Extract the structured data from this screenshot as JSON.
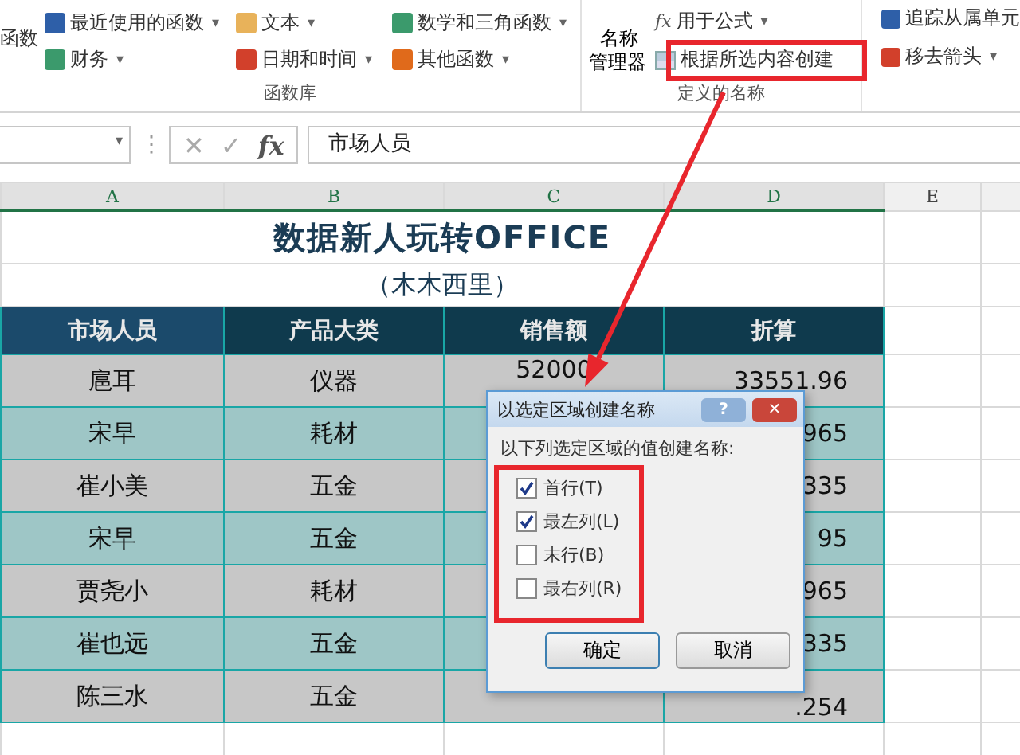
{
  "ribbon": {
    "cut_button": "函数",
    "function_library": {
      "label": "函数库",
      "items": [
        {
          "label": "最近使用的函数",
          "dropdown": "▾"
        },
        {
          "label": "财务",
          "dropdown": "▾"
        },
        {
          "label": "文本",
          "dropdown": "▾"
        },
        {
          "label": "日期和时间",
          "dropdown": "▾"
        },
        {
          "label": "数学和三角函数",
          "dropdown": "▾"
        },
        {
          "label": "其他函数",
          "dropdown": "▾"
        }
      ]
    },
    "defined_names": {
      "label": "定义的名称",
      "formula_icon": "fx",
      "manager": "名称管理器",
      "use_in_formula": "用于公式",
      "use_dropdown": "▾",
      "create_from_selection": "根据所选内容创建"
    },
    "auditing": {
      "items": [
        "追踪从属单元",
        "移去箭头"
      ],
      "dropdown": "▾"
    }
  },
  "formula_bar": {
    "name_dropdown": "▾",
    "more": "⋮",
    "cancel": "✕",
    "enter": "✓",
    "function": "fx",
    "content": "市场人员"
  },
  "sheet": {
    "columns": [
      "A",
      "B",
      "C",
      "D",
      "E"
    ],
    "title": "数据新人玩转OFFICE",
    "subtitle": "（木木西里）",
    "header": [
      "市场人员",
      "产品大类",
      "销售额",
      "折算"
    ],
    "rows": [
      {
        "cells": [
          "扈耳",
          "仪器",
          "52000",
          "33551.96"
        ]
      },
      {
        "cells": [
          "宋早",
          "耗材",
          "",
          "965"
        ]
      },
      {
        "cells": [
          "崔小美",
          "五金",
          "",
          "335"
        ]
      },
      {
        "cells": [
          "宋早",
          "五金",
          "",
          "95"
        ]
      },
      {
        "cells": [
          "贾尧小",
          "耗材",
          "",
          "965"
        ]
      },
      {
        "cells": [
          "崔也远",
          "五金",
          "",
          "335"
        ]
      },
      {
        "cells": [
          "陈三水",
          "五金",
          "",
          ".254"
        ]
      }
    ]
  },
  "dialog": {
    "title": "以选定区域创建名称",
    "help": "?",
    "close": "✕",
    "prompt": "以下列选定区域的值创建名称:",
    "options": [
      {
        "label": "首行(T)",
        "checked": true
      },
      {
        "label": "最左列(L)",
        "checked": true
      },
      {
        "label": "末行(B)",
        "checked": false
      },
      {
        "label": "最右列(R)",
        "checked": false
      }
    ],
    "ok": "确定",
    "cancel": "取消"
  }
}
